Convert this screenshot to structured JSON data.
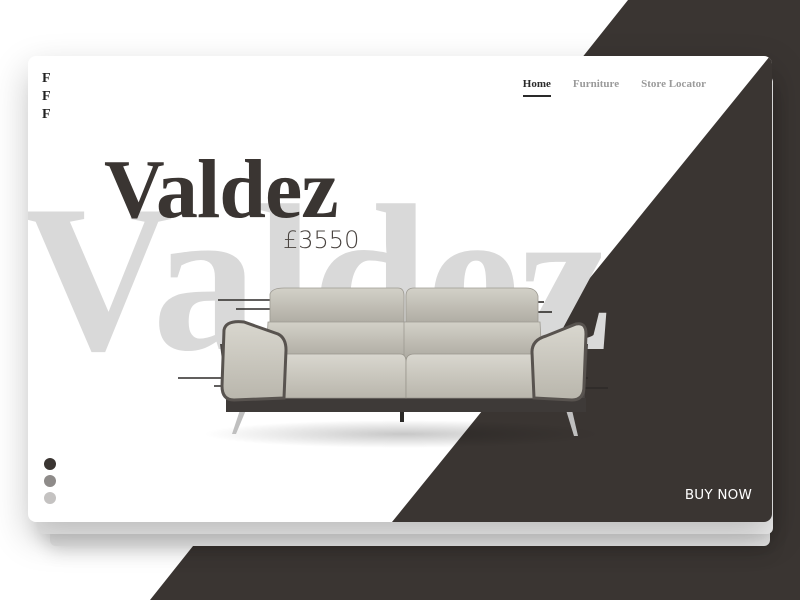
{
  "brand": {
    "logo_lines": [
      "F",
      "F",
      "F"
    ]
  },
  "nav": {
    "items": [
      {
        "label": "Home",
        "active": true
      },
      {
        "label": "Furniture",
        "active": false
      },
      {
        "label": "Store Locator",
        "active": false
      }
    ]
  },
  "hero": {
    "title": "Valdez",
    "watermark": "Valdez",
    "price": "£3550",
    "cta_label": "BUY NOW"
  },
  "pagination": {
    "count": 3,
    "active_index": 0
  },
  "colors": {
    "dark": "#3a3532",
    "white": "#ffffff",
    "watermark": "#d9d9d9",
    "nav_inactive": "#9a9a9a"
  }
}
